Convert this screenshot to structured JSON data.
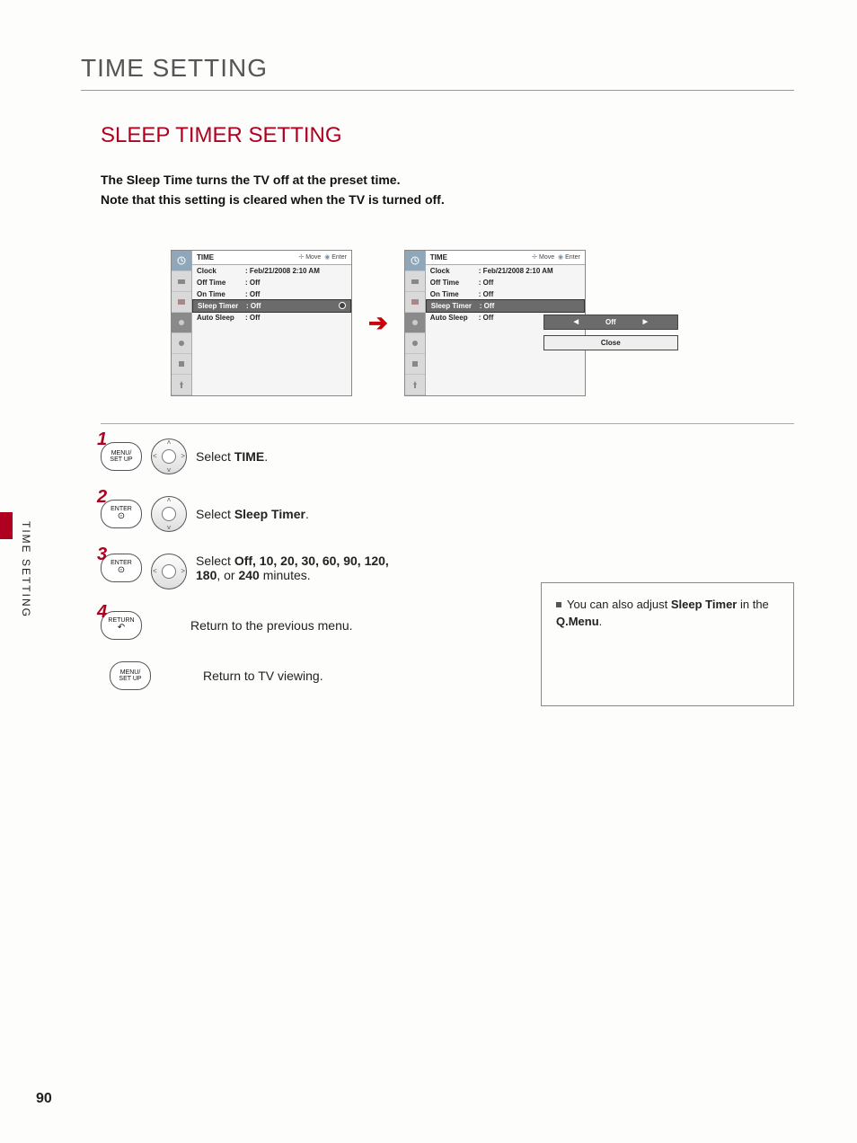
{
  "page": {
    "title": "TIME SETTING",
    "subtitle": "SLEEP TIMER SETTING",
    "intro_line1": "The Sleep Time turns the TV off at the preset time.",
    "intro_line2": "Note that this setting is cleared when the TV is turned off.",
    "side_tab": "TIME SETTING",
    "page_number": "90"
  },
  "osd": {
    "header_title": "TIME",
    "header_hint_move": "Move",
    "header_hint_enter": "Enter",
    "rows": {
      "clock_label": "Clock",
      "clock_value": ": Feb/21/2008  2:10 AM",
      "off_time_label": "Off Time",
      "off_time_value": ": Off",
      "on_time_label": "On Time",
      "on_time_value": ": Off",
      "sleep_timer_label": "Sleep Timer",
      "sleep_timer_value": ": Off",
      "auto_sleep_label": "Auto Sleep",
      "auto_sleep_value": ": Off"
    },
    "popup_value": "Off",
    "popup_close": "Close"
  },
  "steps": {
    "s1": {
      "num": "1",
      "btn": "MENU/\nSET UP",
      "text_prefix": "Select ",
      "text_bold": "TIME",
      "text_suffix": "."
    },
    "s2": {
      "num": "2",
      "btn": "ENTER",
      "text_prefix": "Select ",
      "text_bold": "Sleep Timer",
      "text_suffix": "."
    },
    "s3": {
      "num": "3",
      "btn": "ENTER",
      "text_prefix": "Select ",
      "opts": "Off, 10, 20, 30, 60, 90, 120, 180",
      "text_mid": ", or ",
      "opt_last": "240",
      "text_suffix": " minutes."
    },
    "s4": {
      "num": "4",
      "btn": "RETURN",
      "text": "Return to the previous menu."
    },
    "s5": {
      "btn": "MENU/\nSET UP",
      "text": "Return to TV viewing."
    }
  },
  "tip": {
    "prefix": "You can also adjust ",
    "bold1": "Sleep Timer",
    "mid": " in the ",
    "bold2": "Q.Menu",
    "suffix": "."
  }
}
